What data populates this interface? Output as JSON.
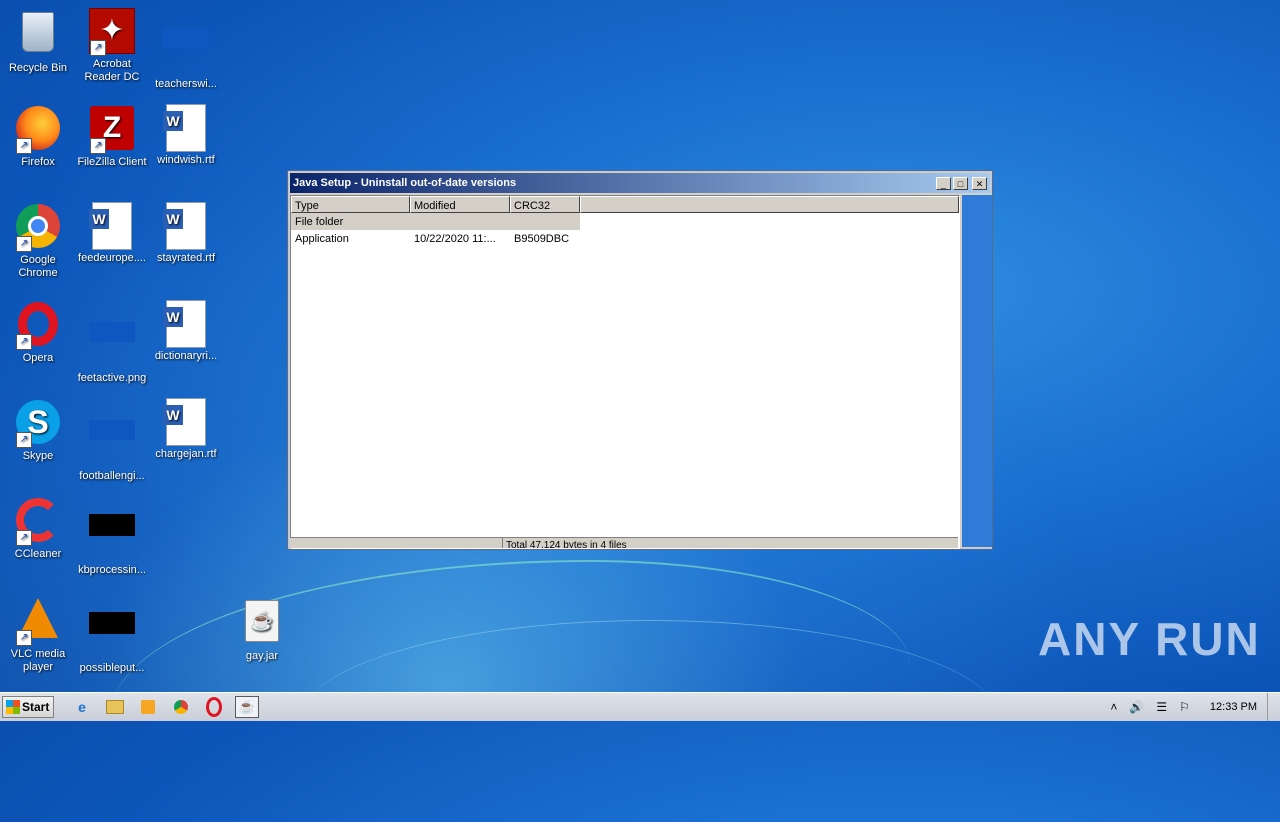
{
  "desktop": {
    "icons": [
      {
        "label": "Recycle Bin",
        "icon": "recycle-bin-icon"
      },
      {
        "label": "Acrobat Reader DC",
        "icon": "acrobat-icon"
      },
      {
        "label": "teacherswi...",
        "icon": "file-icon"
      },
      {
        "label": "Firefox",
        "icon": "firefox-icon"
      },
      {
        "label": "FileZilla Client",
        "icon": "filezilla-icon"
      },
      {
        "label": "windwish.rtf",
        "icon": "word-document-icon"
      },
      {
        "label": "Google Chrome",
        "icon": "chrome-icon"
      },
      {
        "label": "feedeurope....",
        "icon": "word-document-icon"
      },
      {
        "label": "stayrated.rtf",
        "icon": "word-document-icon"
      },
      {
        "label": "Opera",
        "icon": "opera-icon"
      },
      {
        "label": "feetactive.png",
        "icon": "image-file-icon"
      },
      {
        "label": "dictionaryri...",
        "icon": "word-document-icon"
      },
      {
        "label": "Skype",
        "icon": "skype-icon"
      },
      {
        "label": "footballengi...",
        "icon": "file-icon"
      },
      {
        "label": "chargejan.rtf",
        "icon": "word-document-icon"
      },
      {
        "label": "CCleaner",
        "icon": "ccleaner-icon"
      },
      {
        "label": "kbprocessin...",
        "icon": "file-icon"
      },
      {
        "label": "VLC media player",
        "icon": "vlc-icon"
      },
      {
        "label": "possibleput...",
        "icon": "file-icon"
      },
      {
        "label": "gay.jar",
        "icon": "java-jar-icon"
      }
    ]
  },
  "window": {
    "title": "Java Setup - Uninstall out-of-date versions",
    "columns": [
      "Type",
      "Modified",
      "CRC32"
    ],
    "rows": [
      {
        "type": "File folder",
        "modified": "",
        "crc32": ""
      },
      {
        "type": "Application",
        "modified": "10/22/2020 11:...",
        "crc32": "B9509DBC"
      }
    ],
    "status_text": "Total 47,124 bytes in 4 files"
  },
  "watermark": "ANY RUN",
  "taskbar": {
    "start_label": "Start",
    "clock": "12:33 PM"
  }
}
